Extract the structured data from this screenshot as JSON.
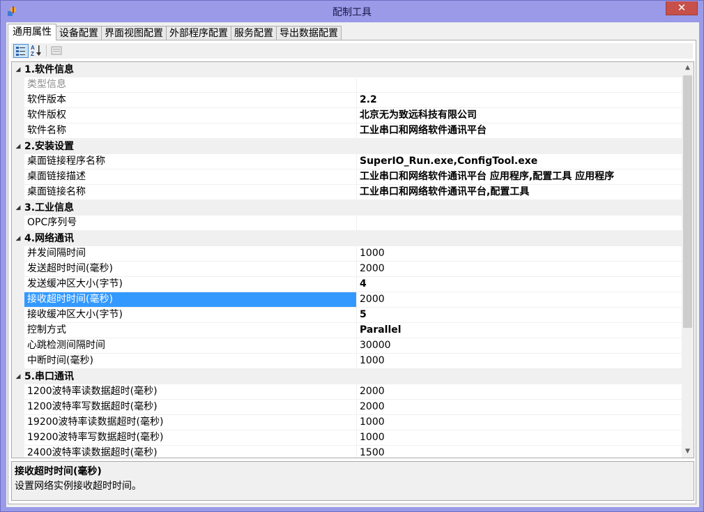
{
  "window": {
    "title": "配制工具",
    "close_label": "✕"
  },
  "tabs": [
    "通用属性",
    "设备配置",
    "界面视图配置",
    "外部程序配置",
    "服务配置",
    "导出数据配置"
  ],
  "grid": {
    "rows": [
      {
        "type": "category",
        "label": "1.软件信息"
      },
      {
        "type": "prop",
        "name": "类型信息",
        "value": "",
        "gray": true
      },
      {
        "type": "prop",
        "name": "软件版本",
        "value": "2.2",
        "bold": true
      },
      {
        "type": "prop",
        "name": "软件版权",
        "value": "北京无为致远科技有限公司",
        "bold": true
      },
      {
        "type": "prop",
        "name": "软件名称",
        "value": "工业串口和网络软件通讯平台",
        "bold": true
      },
      {
        "type": "category",
        "label": "2.安装设置"
      },
      {
        "type": "prop",
        "name": "桌面链接程序名称",
        "value": "SuperIO_Run.exe,ConfigTool.exe",
        "bold": true
      },
      {
        "type": "prop",
        "name": "桌面链接描述",
        "value": "工业串口和网络软件通讯平台 应用程序,配置工具 应用程序",
        "bold": true
      },
      {
        "type": "prop",
        "name": "桌面链接名称",
        "value": "工业串口和网络软件通讯平台,配置工具",
        "bold": true
      },
      {
        "type": "category",
        "label": "3.工业信息"
      },
      {
        "type": "prop",
        "name": "OPC序列号",
        "value": ""
      },
      {
        "type": "category",
        "label": "4.网络通讯"
      },
      {
        "type": "prop",
        "name": "并发间隔时间",
        "value": "1000"
      },
      {
        "type": "prop",
        "name": "发送超时时间(毫秒)",
        "value": "2000"
      },
      {
        "type": "prop",
        "name": "发送缓冲区大小(字节)",
        "value": "4",
        "bold": true
      },
      {
        "type": "prop",
        "name": "接收超时时间(毫秒)",
        "value": "2000",
        "selected": true
      },
      {
        "type": "prop",
        "name": "接收缓冲区大小(字节)",
        "value": "5",
        "bold": true
      },
      {
        "type": "prop",
        "name": "控制方式",
        "value": "Parallel",
        "bold": true
      },
      {
        "type": "prop",
        "name": "心跳检测间隔时间",
        "value": "30000"
      },
      {
        "type": "prop",
        "name": "中断时间(毫秒)",
        "value": "1000"
      },
      {
        "type": "category",
        "label": "5.串口通讯"
      },
      {
        "type": "prop",
        "name": "1200波特率读数据超时(毫秒)",
        "value": "2000"
      },
      {
        "type": "prop",
        "name": "1200波特率写数据超时(毫秒)",
        "value": "2000"
      },
      {
        "type": "prop",
        "name": "19200波特率读数据超时(毫秒)",
        "value": "1000"
      },
      {
        "type": "prop",
        "name": "19200波特率写数据超时(毫秒)",
        "value": "1000"
      },
      {
        "type": "prop",
        "name": "2400波特率读数据超时(毫秒)",
        "value": "1500"
      }
    ]
  },
  "help": {
    "title": "接收超时时间(毫秒)",
    "description": "设置网络实例接收超时时间。"
  },
  "colors": {
    "selection": "#3399ff",
    "frame": "#9a9ae8",
    "close": "#c7504a"
  },
  "icons": [
    "app-icon",
    "categorized-icon",
    "alphabetical-icon",
    "property-pages-icon",
    "collapse-arrow-icon",
    "scroll-up-icon",
    "scroll-down-icon",
    "close-icon"
  ]
}
